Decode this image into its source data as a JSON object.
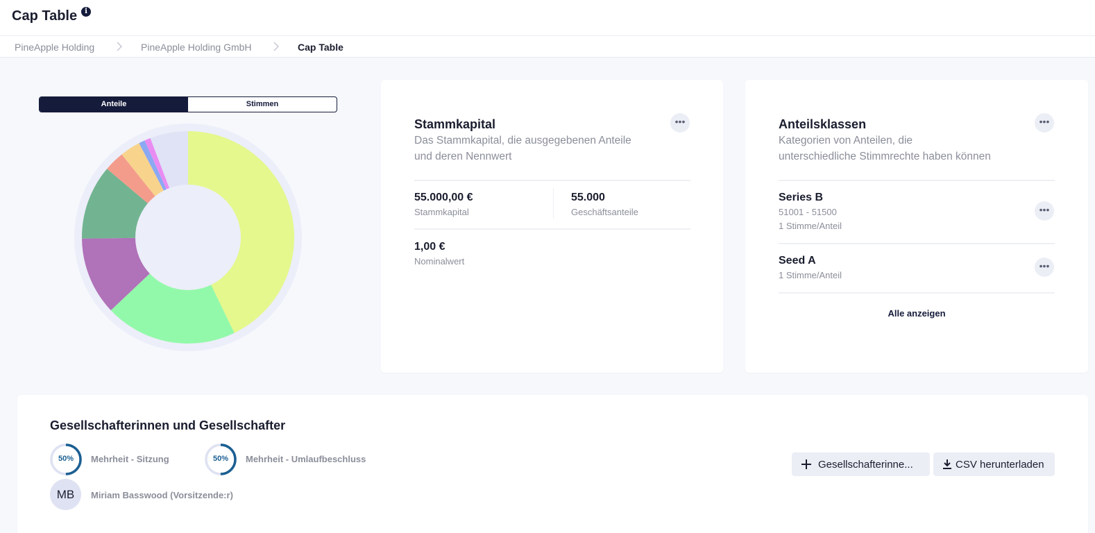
{
  "header": {
    "title": "Cap Table",
    "info_icon": "info-icon"
  },
  "breadcrumb": [
    "PineApple Holding",
    "PineApple Holding GmbH",
    "Cap Table"
  ],
  "tabs": [
    {
      "label": "Anteile",
      "active": true
    },
    {
      "label": "Stimmen",
      "active": false
    }
  ],
  "chart_data": {
    "type": "pie",
    "categories": [
      "",
      "",
      "",
      "",
      "",
      "",
      "",
      "",
      ""
    ],
    "values": [
      41.5,
      19.5,
      11.5,
      11.0,
      3.0,
      3.0,
      0.9,
      0.9,
      5.6
    ],
    "colors": [
      "#e4f88d",
      "#93f9aa",
      "#b072b9",
      "#72b491",
      "#f49c8c",
      "#f8d38c",
      "#8ba8f2",
      "#e98cf2",
      "#dfe3f5"
    ],
    "title": "",
    "xlabel": "",
    "ylabel": ""
  },
  "stammkapital": {
    "title": "Stammkapital",
    "subtitle_line1": "Das Stammkapital, die ausgegebenen Anteile",
    "subtitle_line2": "und deren Nennwert",
    "capital_value": "55.000,00 €",
    "capital_label": "Stammkapital",
    "shares_value": "55.000",
    "shares_label": "Geschäftsanteile",
    "nominal_value": "1,00 €",
    "nominal_label": "Nominalwert"
  },
  "anteilsklassen": {
    "title": "Anteilsklassen",
    "subtitle_line1": "Kategorien von Anteilen, die",
    "subtitle_line2": "unterschiedliche Stimmrechte haben können",
    "classes": [
      {
        "name": "Series B",
        "range": "51001 - 51500",
        "votes": "1 Stimme/Anteil"
      },
      {
        "name": "Seed A",
        "votes": "1 Stimme/Anteil"
      }
    ],
    "show_all": "Alle anzeigen"
  },
  "shareholders": {
    "title": "Gesellschafterinnen und Gesellschafter",
    "majority_meeting": {
      "percent": "50%",
      "label": "Mehrheit - Sitzung",
      "value": 0.5
    },
    "majority_circular": {
      "percent": "50%",
      "label": "Mehrheit - Umlaufbeschluss",
      "value": 0.5
    },
    "chair": {
      "initials": "MB",
      "name": "Miriam Basswood (Vorsitzende:r)"
    },
    "add_button": "Gesellschafterinne...",
    "csv_button": "CSV herunterladen"
  },
  "colors": {
    "primary": "#151b3a",
    "ring": "#1b5f92",
    "muted": "#8b8e9a"
  }
}
